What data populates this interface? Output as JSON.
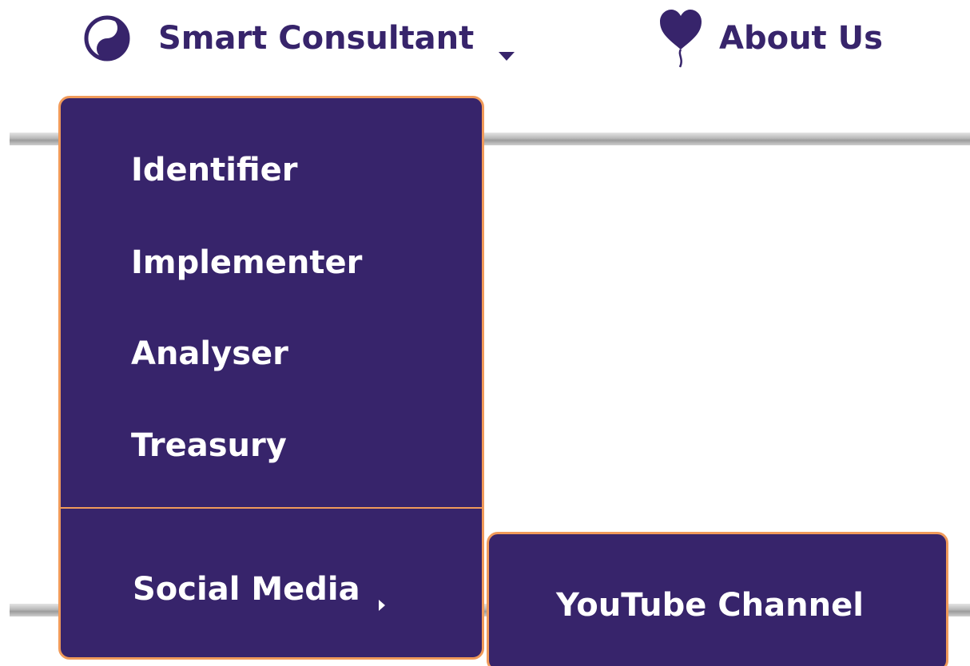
{
  "nav": {
    "consultant": {
      "label": "Smart Consultant",
      "icon": "yin-yang-icon"
    },
    "about": {
      "label": "About Us",
      "icon": "heart-balloon-icon"
    }
  },
  "dropdown": {
    "items": [
      {
        "label": "Identifier"
      },
      {
        "label": "Implementer"
      },
      {
        "label": "Analyser"
      },
      {
        "label": "Treasury"
      }
    ],
    "social": {
      "label": "Social Media"
    }
  },
  "submenu": {
    "items": [
      {
        "label": "YouTube Channel"
      }
    ]
  },
  "colors": {
    "primary": "#37246b",
    "border": "#f09a5a",
    "menu_text": "#ffffff"
  }
}
